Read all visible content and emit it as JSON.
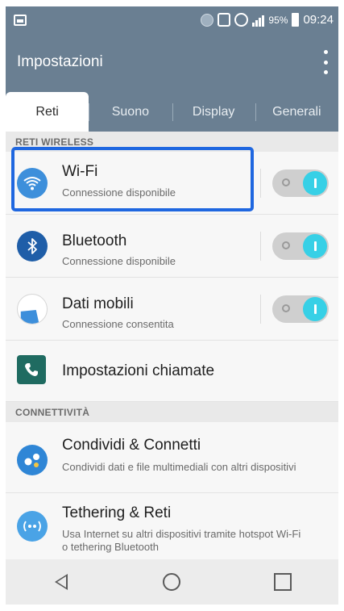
{
  "status_bar": {
    "battery_percent": "95%",
    "time": "09:24",
    "icons": [
      "image-icon",
      "bluetooth-status-icon",
      "nfc-icon",
      "alarm-icon",
      "signal-icon",
      "battery-icon"
    ]
  },
  "app_bar": {
    "title": "Impostazioni",
    "menu_icon": "overflow-menu-icon"
  },
  "tabs": [
    {
      "label": "Reti",
      "active": true
    },
    {
      "label": "Suono",
      "active": false
    },
    {
      "label": "Display",
      "active": false
    },
    {
      "label": "Generali",
      "active": false
    }
  ],
  "sections": {
    "wireless": {
      "header": "RETI WIRELESS"
    },
    "connectivity": {
      "header": "CONNETTIVITÀ"
    }
  },
  "items": {
    "wifi": {
      "title": "Wi-Fi",
      "subtitle": "Connessione disponibile",
      "toggle_on": true,
      "icon": "wifi-icon"
    },
    "bluetooth": {
      "title": "Bluetooth",
      "subtitle": "Connessione disponibile",
      "toggle_on": true,
      "icon": "bluetooth-icon"
    },
    "mobile_data": {
      "title": "Dati mobili",
      "subtitle": "Connessione consentita",
      "toggle_on": true,
      "icon": "mobile-data-icon"
    },
    "call_settings": {
      "title": "Impostazioni chiamate",
      "icon": "phone-icon"
    },
    "share_connect": {
      "title": "Condividi & Connetti",
      "subtitle": "Condividi dati e file multimediali con altri dispositivi",
      "icon": "share-connect-icon"
    },
    "tethering": {
      "title": "Tethering & Reti",
      "subtitle": "Usa Internet su altri dispositivi tramite hotspot Wi-Fi o tethering Bluetooth",
      "icon": "tethering-icon"
    }
  },
  "colors": {
    "header": "#6a7f92",
    "toggle_accent": "#37d0e6",
    "highlight_border": "#1f67e0"
  },
  "nav_bar": {
    "icons": [
      "back-icon",
      "home-icon",
      "recent-apps-icon"
    ]
  }
}
